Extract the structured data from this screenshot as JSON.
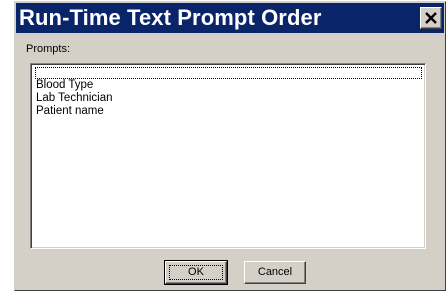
{
  "window": {
    "title": "Run-Time Text Prompt Order",
    "close_icon": "close-icon"
  },
  "prompts": {
    "label": "Prompts:",
    "items": [
      "",
      "Blood Type",
      "Lab Technician",
      "Patient name"
    ]
  },
  "buttons": {
    "ok_label": "OK",
    "cancel_label": "Cancel"
  },
  "colors": {
    "titlebar": "#0a246a",
    "face": "#d4d0c8",
    "list_bg": "#ffffff"
  }
}
